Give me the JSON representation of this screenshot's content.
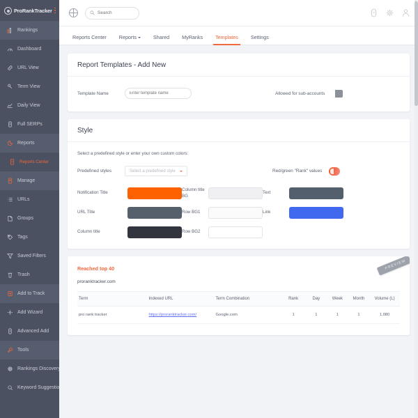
{
  "sidebar": {
    "logo": "ProRankTracker",
    "menu_icon": "hamburger-icon",
    "items": [
      {
        "label": "Rankings",
        "icon": "bar-chart-icon",
        "active": true,
        "sub": false
      },
      {
        "label": "Dashboard",
        "icon": "dashboard-icon",
        "active": false,
        "sub": false
      },
      {
        "label": "URL View",
        "icon": "link-icon",
        "active": false,
        "sub": false
      },
      {
        "label": "Term View",
        "icon": "key-icon",
        "active": false,
        "sub": false
      },
      {
        "label": "Daily View",
        "icon": "line-chart-icon",
        "active": false,
        "sub": false
      },
      {
        "label": "Full SERPs",
        "icon": "serp-icon",
        "active": false,
        "sub": false
      },
      {
        "label": "Reports",
        "icon": "reports-icon",
        "active": true,
        "sub": false
      },
      {
        "label": "Reports Center",
        "icon": "report-doc-icon",
        "active": false,
        "sub": true
      },
      {
        "label": "Manage",
        "icon": "manage-icon",
        "active": true,
        "sub": false
      },
      {
        "label": "URLs",
        "icon": "list-icon",
        "active": false,
        "sub": false
      },
      {
        "label": "Groups",
        "icon": "folder-icon",
        "active": false,
        "sub": false
      },
      {
        "label": "Tags",
        "icon": "tag-icon",
        "active": false,
        "sub": false
      },
      {
        "label": "Saved Filters",
        "icon": "filter-icon",
        "active": false,
        "sub": false
      },
      {
        "label": "Trash",
        "icon": "trash-icon",
        "active": false,
        "sub": false
      },
      {
        "label": "Add to Track",
        "icon": "plus-box-icon",
        "active": true,
        "sub": false
      },
      {
        "label": "Add Wizard",
        "icon": "wizard-icon",
        "active": false,
        "sub": false
      },
      {
        "label": "Advanced Add",
        "icon": "advanced-add-icon",
        "active": false,
        "sub": false
      },
      {
        "label": "Tools",
        "icon": "tools-icon",
        "active": true,
        "sub": false
      },
      {
        "label": "Rankings Discovery",
        "icon": "discovery-icon",
        "active": false,
        "sub": false
      },
      {
        "label": "Keyword Suggestions",
        "icon": "keyword-icon",
        "active": false,
        "sub": false
      }
    ]
  },
  "topbar": {
    "globe_icon": "globe-icon",
    "search": {
      "value": "",
      "placeholder": "Search",
      "icon": "search-icon"
    },
    "actions": [
      {
        "name": "help-icon"
      },
      {
        "name": "gear-icon"
      },
      {
        "name": "user-icon"
      }
    ]
  },
  "tabs": [
    {
      "label": "Reports Center",
      "active": false,
      "caret": false
    },
    {
      "label": "Reports",
      "active": false,
      "caret": true
    },
    {
      "label": "Shared",
      "active": false,
      "caret": false
    },
    {
      "label": "MyRanks",
      "active": false,
      "caret": false
    },
    {
      "label": "Templates",
      "active": true,
      "caret": false
    },
    {
      "label": "Settings",
      "active": false,
      "caret": false
    }
  ],
  "template_card": {
    "title": "Report Templates - Add New",
    "template_name_label": "Template Name",
    "template_name_value": "",
    "template_name_placeholder": "Enter template name",
    "sub_accounts_label": "Allowed for sub-accounts",
    "sub_accounts_state": "off"
  },
  "style_card": {
    "title": "Style",
    "helper": "Select a predefined style or enter your own custom colors:",
    "predefined_label": "Predefined styles",
    "predefined_value": "Select a predefined style",
    "rank_values_label": "Red/green \"Rank\" values",
    "rank_values_state": "on",
    "swatches": [
      {
        "label": "Notification Title",
        "color": "#fc6200",
        "bordered": false
      },
      {
        "label": "Column title BG",
        "color": "#f0f0f2",
        "bordered": true
      },
      {
        "label": "Text",
        "color": "#545f6e",
        "bordered": false
      },
      {
        "label": "URL Title",
        "color": "#565f6c",
        "bordered": false
      },
      {
        "label": "Row BG1",
        "color": "#fbfbfc",
        "bordered": true
      },
      {
        "label": "Link",
        "color": "#4169f0",
        "bordered": false
      },
      {
        "label": "Column title",
        "color": "#32343e",
        "bordered": false
      },
      {
        "label": "Row BG2",
        "color": "#ffffff",
        "bordered": true
      },
      {
        "label": "",
        "color": "",
        "bordered": false
      }
    ]
  },
  "preview_card": {
    "ribbon": "PREVIEW",
    "notification_title": "Reached top 40",
    "domain": "proranktracker.com",
    "columns": [
      "Term",
      "Indexed URL",
      "Term Combination",
      "Rank",
      "Day",
      "Week",
      "Month",
      "Volume (L)"
    ],
    "rows": [
      {
        "term": "pro rank tracker",
        "indexed_url": "https://proranktracker.com/",
        "term_combination": "Google.com",
        "rank": "1",
        "day": "1",
        "week": "1",
        "month": "1",
        "volume": "1,080"
      }
    ]
  }
}
